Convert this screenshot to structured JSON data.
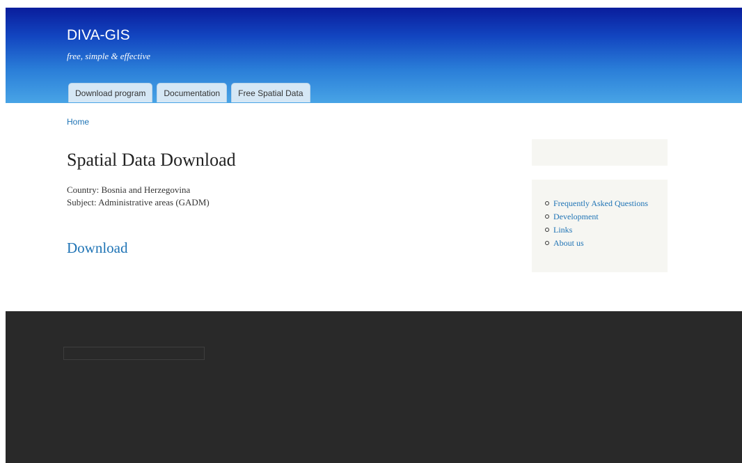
{
  "header": {
    "site_name": "DIVA-GIS",
    "slogan": "free, simple & effective",
    "tabs": [
      {
        "label": "Download program"
      },
      {
        "label": "Documentation"
      },
      {
        "label": "Free Spatial Data"
      }
    ]
  },
  "breadcrumb": {
    "home": "Home"
  },
  "main": {
    "title": "Spatial Data Download",
    "country_line": "Country: Bosnia and Herzegovina",
    "subject_line": "Subject: Administrative areas (GADM)",
    "download_label": "Download"
  },
  "sidebar": {
    "links": [
      {
        "label": "Frequently Asked Questions"
      },
      {
        "label": "Development"
      },
      {
        "label": "Links"
      },
      {
        "label": "About us"
      }
    ]
  },
  "colors": {
    "header_top": "#0a1d9c",
    "header_bottom": "#48a4e6",
    "link": "#1e73b5",
    "footer": "#292929",
    "sidebar_bg": "#f6f6f2"
  }
}
